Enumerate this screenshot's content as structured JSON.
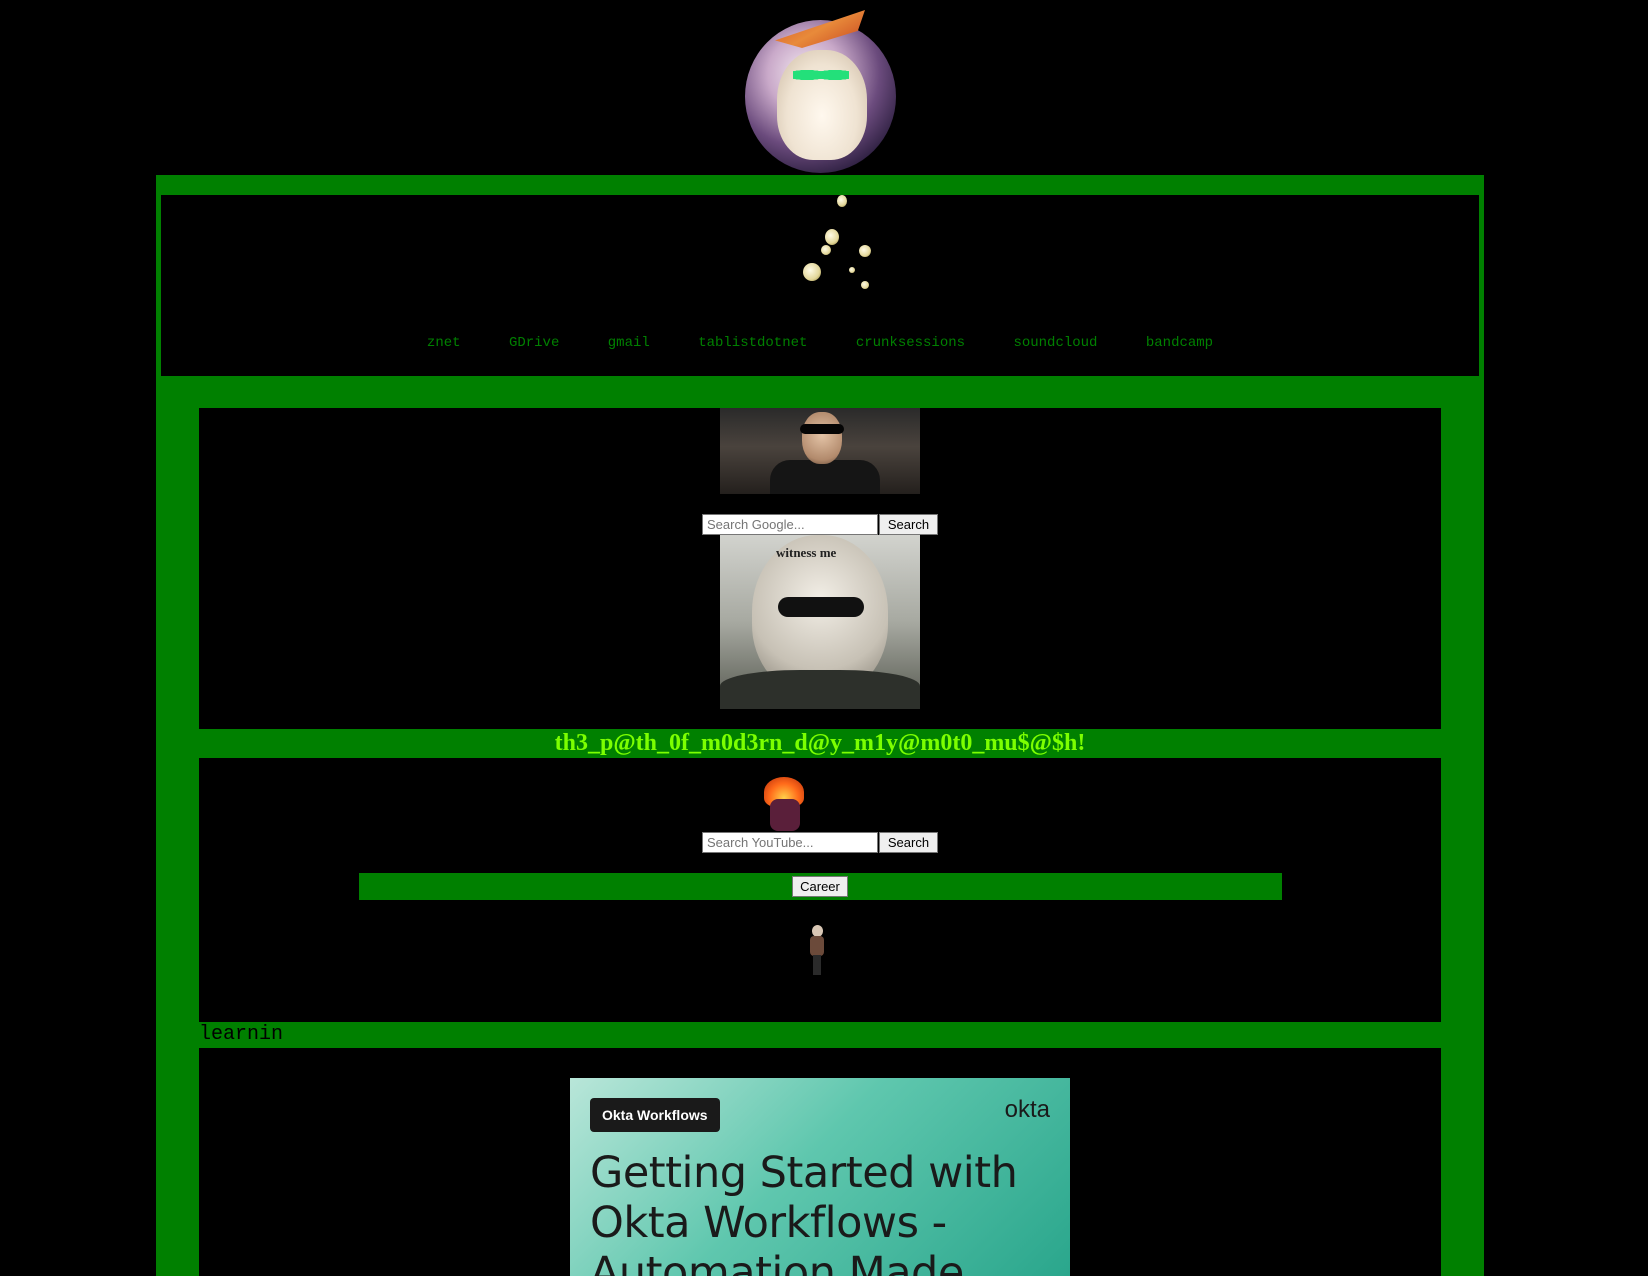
{
  "nav": {
    "links": [
      "znet",
      "GDrive",
      "gmail",
      "tablistdotnet",
      "crunksessions",
      "soundcloud",
      "bandcamp"
    ]
  },
  "google_search": {
    "placeholder": "Search Google...",
    "button": "Search"
  },
  "youtube_search": {
    "placeholder": "Search YouTube...",
    "button": "Search"
  },
  "motto": "th3_p@th_0f_m0d3rn_d@y_m1y@m0t0_mu$@$h!",
  "career_button": "Career",
  "learnin_heading": "learnin",
  "meme_text": "witness me",
  "okta_card": {
    "badge": "Okta Workflows",
    "logo": "okta",
    "headline": "Getting Started with Okta Workflows - Automation Made"
  },
  "colors": {
    "background": "#000000",
    "frame_green": "#008000",
    "motto_green": "#7cff00"
  }
}
